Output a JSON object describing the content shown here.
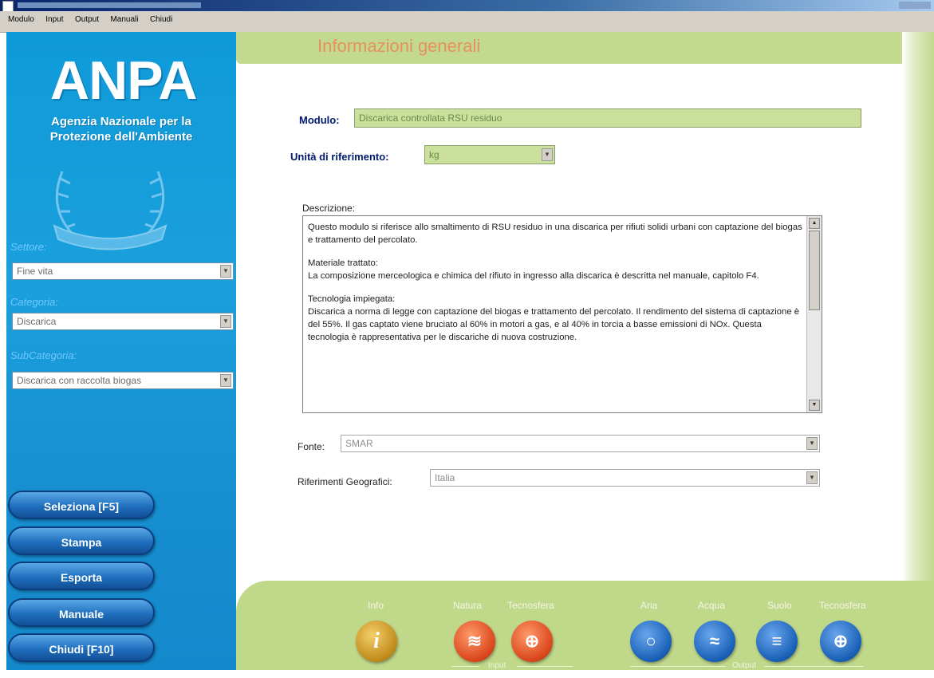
{
  "menu": [
    "Modulo",
    "Input",
    "Output",
    "Manuali",
    "Chiudi"
  ],
  "logo": {
    "name": "ANPA",
    "line1": "Agenzia Nazionale per la",
    "line2": "Protezione dell'Ambiente"
  },
  "sidebar": {
    "settore": {
      "label": "Settore:",
      "value": "Fine vita"
    },
    "categoria": {
      "label": "Categoria:",
      "value": "Discarica"
    },
    "subcategoria": {
      "label": "SubCategoria:",
      "value": "Discarica con raccolta biogas"
    },
    "buttons": [
      "Seleziona [F5]",
      "Stampa",
      "Esporta",
      "Manuale",
      "Chiudi [F10]"
    ]
  },
  "page": {
    "title": "Informazioni generali"
  },
  "form": {
    "modulo_label": "Modulo:",
    "modulo_value": "Discarica controllata RSU residuo",
    "unita_label": "Unità di riferimento:",
    "unita_value": "kg",
    "descrizione_label": "Descrizione:",
    "descrizione": [
      "Questo modulo si riferisce allo smaltimento di RSU residuo in una discarica per rifiuti solidi urbani con captazione del biogas e trattamento del percolato.",
      "Materiale trattato:\nLa composizione merceologica e chimica del rifiuto in ingresso alla discarica è descritta nel manuale, capitolo F4.",
      "Tecnologia impiegata:\nDiscarica a norma di legge con captazione del biogas e trattamento del percolato. Il rendimento del sistema di captazione è del 55%. Il gas captato viene bruciato al 60% in motori a gas, e al 40% in torcia a basse emissioni di NOx. Questa tecnologia è rappresentativa per le discariche di nuova costruzione."
    ],
    "fonte_label": "Fonte:",
    "fonte_value": "SMAR",
    "geo_label": "Riferimenti Geografici:",
    "geo_value": "Italia"
  },
  "toolbar": {
    "info": {
      "label": "Info",
      "icon": "info-icon"
    },
    "natura": {
      "label": "Natura",
      "icon": "water-icon"
    },
    "tecnosfera_in": {
      "label": "Tecnosfera",
      "icon": "crosshair-icon"
    },
    "aria": {
      "label": "Aria",
      "icon": "ring-icon"
    },
    "acqua": {
      "label": "Acqua",
      "icon": "waves-icon"
    },
    "suolo": {
      "label": "Suolo",
      "icon": "lines-icon"
    },
    "tecnosfera_out": {
      "label": "Tecnosfera",
      "icon": "crosshair-icon"
    },
    "group_input": "Input",
    "group_output": "Output"
  },
  "colors": {
    "sidebar_blue": "#1aa0dc",
    "frame_green": "#c3d990",
    "title_orange": "#e7905f",
    "label_navy": "#00196e"
  }
}
